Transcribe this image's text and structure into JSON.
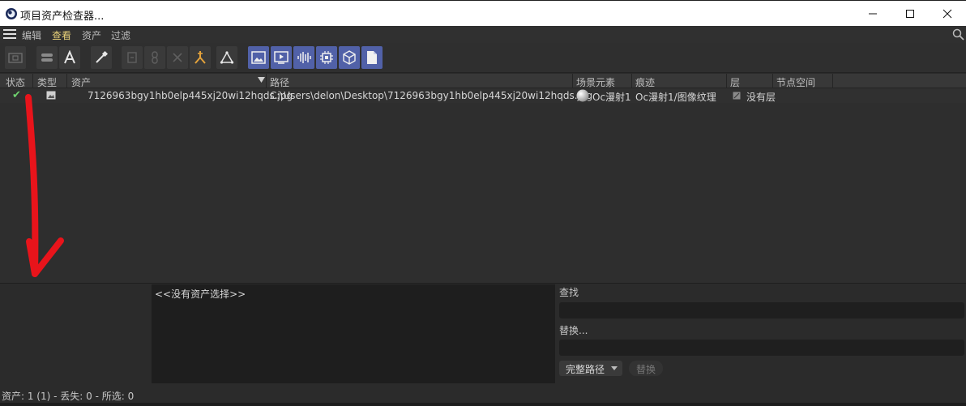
{
  "window": {
    "title": "项目资产检查器...",
    "app_icon": "cinema4d-icon",
    "controls": [
      "minimize-icon",
      "maximize-icon",
      "close-icon"
    ]
  },
  "menu": {
    "items": [
      "编辑",
      "查看",
      "资产",
      "过滤"
    ],
    "active": "查看"
  },
  "toolbar": {
    "buttons": [
      "folder-icon",
      "toggle-icon",
      "text-icon",
      "eyedropper-icon",
      "copy-icon",
      "link-icon",
      "delete-icon",
      "merge-icon",
      "triangle-icon",
      "image-icon",
      "video-icon",
      "audio-icon",
      "chip-icon",
      "cube-icon",
      "document-icon"
    ],
    "accent": "#5161a8"
  },
  "table": {
    "headers": [
      "状态",
      "类型",
      "资产",
      "路径",
      "场景元素",
      "痕迹",
      "层",
      "节点空间"
    ],
    "rows": [
      {
        "status": "✔",
        "type": "image-icon",
        "asset": "7126963bgy1hb0elp445xj20wi12hqds.jpg",
        "path": "C:\\Users\\delon\\Desktop\\7126963bgy1hb0elp445xj20wi12hqds.jpg",
        "scene_element": "Oc漫射1",
        "trace": "Oc漫射1/图像纹理",
        "layer": "没有层",
        "node_space": ""
      }
    ]
  },
  "info": {
    "selection": "<<没有资产选择>>"
  },
  "find": {
    "label": "查找",
    "value": ""
  },
  "replace": {
    "label": "替换...",
    "value": "",
    "mode": "完整路径",
    "button": "替换"
  },
  "status": {
    "text": "资产: 1 (1) - 丢失: 0 - 所选: 0"
  },
  "annotation": {
    "color": "#e8141b"
  }
}
